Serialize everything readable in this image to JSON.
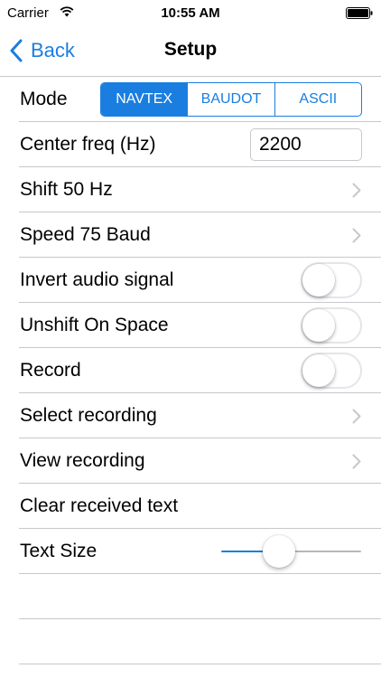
{
  "status_bar": {
    "carrier": "Carrier",
    "time": "10:55 AM"
  },
  "nav": {
    "back_label": "Back",
    "title": "Setup"
  },
  "accent_color": "#1a7ee0",
  "settings": {
    "mode": {
      "label": "Mode",
      "options": [
        "NAVTEX",
        "BAUDOT",
        "ASCII"
      ],
      "selected": "NAVTEX"
    },
    "center_freq": {
      "label": "Center freq (Hz)",
      "value": "2200"
    },
    "shift": {
      "label": "Shift 50 Hz"
    },
    "speed": {
      "label": "Speed 75 Baud"
    },
    "invert_audio": {
      "label": "Invert audio signal",
      "on": false
    },
    "unshift_on_space": {
      "label": "Unshift On Space",
      "on": false
    },
    "record": {
      "label": "Record",
      "on": false
    },
    "select_recording": {
      "label": "Select recording"
    },
    "view_recording": {
      "label": "View recording"
    },
    "clear_text": {
      "label": "Clear received text"
    },
    "text_size": {
      "label": "Text Size",
      "value_fraction": 0.39
    }
  }
}
